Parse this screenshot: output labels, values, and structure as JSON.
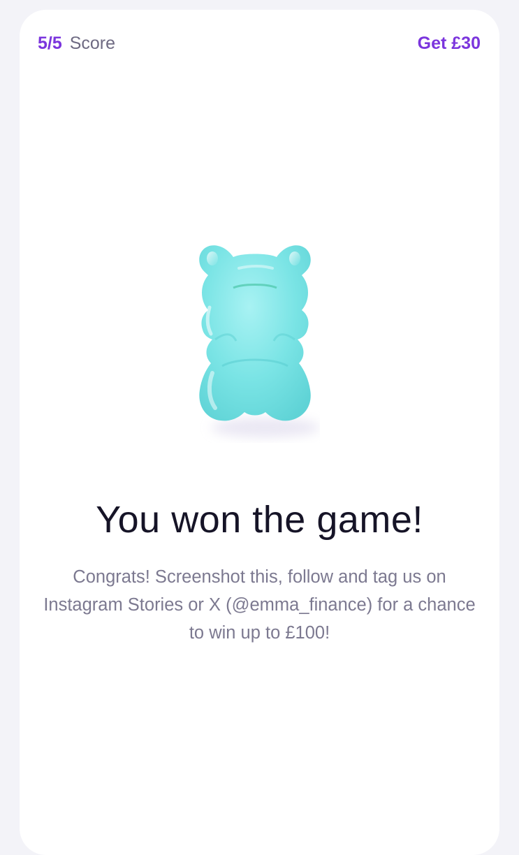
{
  "header": {
    "score_value": "5/5",
    "score_label": "Score",
    "reward_label": "Get £30"
  },
  "illustration": {
    "icon": "gummy-bear-icon",
    "color": "#74e3e4"
  },
  "result": {
    "title": "You won the game!",
    "message": "Congrats! Screenshot this, follow and tag us on Instagram Stories or X (@emma_finance) for a chance to win up to £100!"
  },
  "colors": {
    "accent": "#7b35dd",
    "title": "#161427",
    "body_text": "#7c7990",
    "background": "#f3f3f8"
  }
}
